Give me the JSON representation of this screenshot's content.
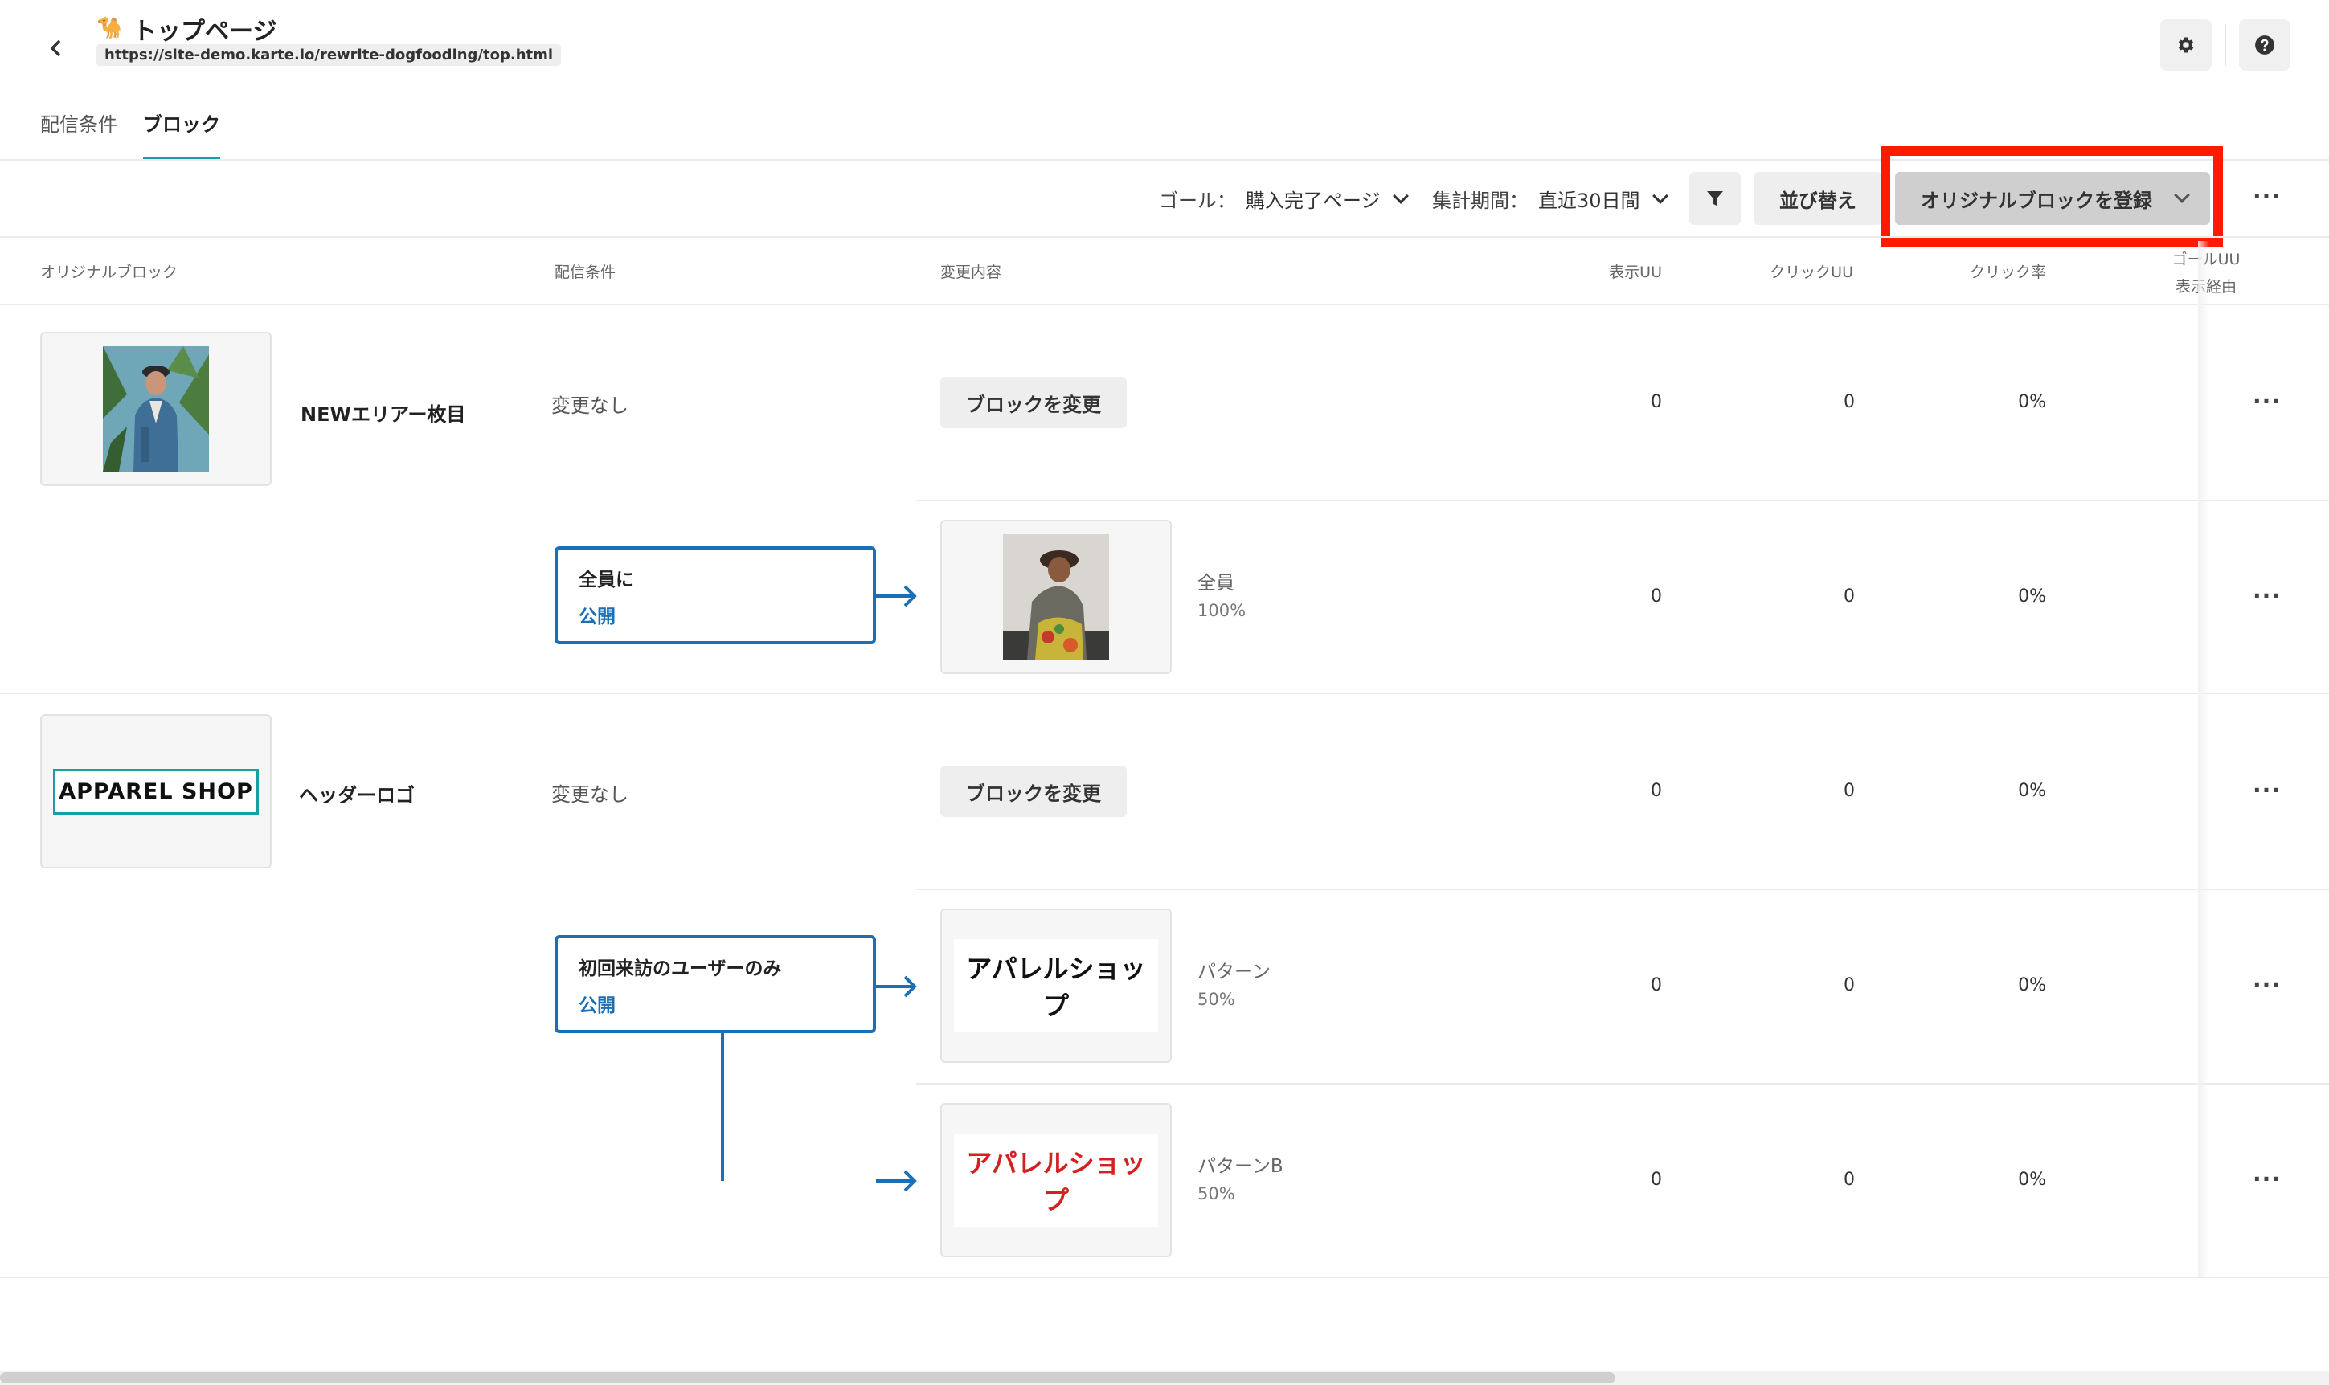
{
  "header": {
    "title_icon": "🐪",
    "title": "トップページ",
    "url": "https://site-demo.karte.io/rewrite-dogfooding/top.html"
  },
  "tabs": [
    {
      "label": "配信条件",
      "active": false
    },
    {
      "label": "ブロック",
      "active": true
    }
  ],
  "toolbar": {
    "goal_label": "ゴール：",
    "goal_value": "購入完了ページ",
    "period_label": "集計期間：",
    "period_value": "直近30日間",
    "sort_label": "並び替え",
    "register_label": "オリジナルブロックを登録",
    "more": "···"
  },
  "columns": {
    "original_block": "オリジナルブロック",
    "condition": "配信条件",
    "change": "変更内容",
    "view_uu": "表示UU",
    "click_uu": "クリックUU",
    "click_rate": "クリック率",
    "goal_uu_line1": "ゴールUU",
    "goal_uu_line2": "表示経由"
  },
  "blocks": [
    {
      "name": "NEWエリアー枚目",
      "condition": "変更なし",
      "change_button": "ブロックを変更",
      "view_uu": "0",
      "click_uu": "0",
      "click_rate": "0%",
      "variants": [
        {
          "cond_title": "全員に",
          "cond_status": "公開",
          "variant_name": "全員",
          "variant_pct": "100%",
          "view_uu": "0",
          "click_uu": "0",
          "click_rate": "0%"
        }
      ]
    },
    {
      "name": "ヘッダーロゴ",
      "logo_text": "APPAREL SHOP",
      "condition": "変更なし",
      "change_button": "ブロックを変更",
      "view_uu": "0",
      "click_uu": "0",
      "click_rate": "0%",
      "variants": [
        {
          "cond_title": "初回来訪のユーザーのみ",
          "cond_status": "公開",
          "thumb_text": "アパレルショップ",
          "variant_name": "パターン",
          "variant_pct": "50%",
          "view_uu": "0",
          "click_uu": "0",
          "click_rate": "0%"
        },
        {
          "thumb_text": "アパレルショップ",
          "variant_name": "パターンB",
          "variant_pct": "50%",
          "view_uu": "0",
          "click_uu": "0",
          "click_rate": "0%"
        }
      ]
    }
  ],
  "colors": {
    "accent": "#1a9ea6",
    "condition_blue": "#1a6fb5",
    "highlight_red": "#ff1a00",
    "variant_red": "#d42020"
  }
}
